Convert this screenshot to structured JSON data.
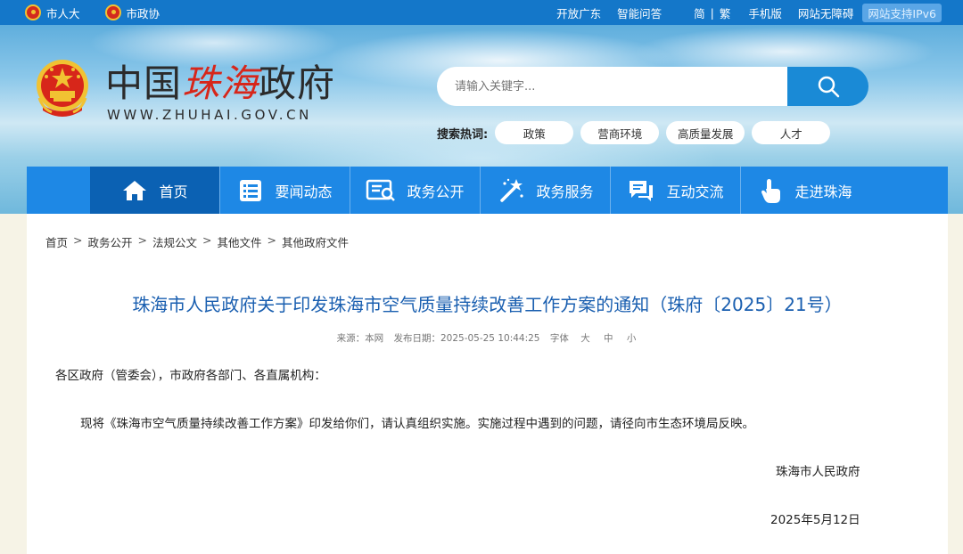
{
  "topbar": {
    "left_links": [
      {
        "label": "市人大"
      },
      {
        "label": "市政协"
      }
    ],
    "right_links": [
      "开放广东",
      "智能问答",
      "简",
      "|",
      "繁",
      "手机版",
      "网站无障碍"
    ],
    "ipv6": "网站支持IPv6"
  },
  "header": {
    "logo_prefix": "中国",
    "logo_city": "珠海",
    "logo_suffix": "政府",
    "logo_url": "WWW.ZHUHAI.GOV.CN"
  },
  "search": {
    "placeholder": "请输入关键字...",
    "hot_label": "搜索热词:",
    "hot_words": [
      "政策",
      "营商环境",
      "高质量发展",
      "人才"
    ]
  },
  "nav": {
    "items": [
      {
        "label": "首页",
        "icon": "home-icon"
      },
      {
        "label": "要闻动态",
        "icon": "news-list-icon"
      },
      {
        "label": "政务公开",
        "icon": "document-icon"
      },
      {
        "label": "政务服务",
        "icon": "magic-wand-icon"
      },
      {
        "label": "互动交流",
        "icon": "chat-icon"
      },
      {
        "label": "走进珠海",
        "icon": "hand-pointer-icon"
      }
    ]
  },
  "breadcrumb": [
    "首页",
    "政务公开",
    "法规公文",
    "其他文件",
    "其他政府文件"
  ],
  "article": {
    "title": "珠海市人民政府关于印发珠海市空气质量持续改善工作方案的通知（珠府〔2025〕21号）",
    "source": "来源：本网",
    "publish_date": "发布日期：2025-05-25 10:44:25",
    "font_label": "字体",
    "font_sizes": [
      "大",
      "中",
      "小"
    ],
    "salutation": "各区政府（管委会），市政府各部门、各直属机构：",
    "body": "现将《珠海市空气质量持续改善工作方案》印发给你们，请认真组织实施。实施过程中遇到的问题，请径向市生态环境局反映。",
    "signature": "珠海市人民政府",
    "date": "2025年5月12日"
  }
}
